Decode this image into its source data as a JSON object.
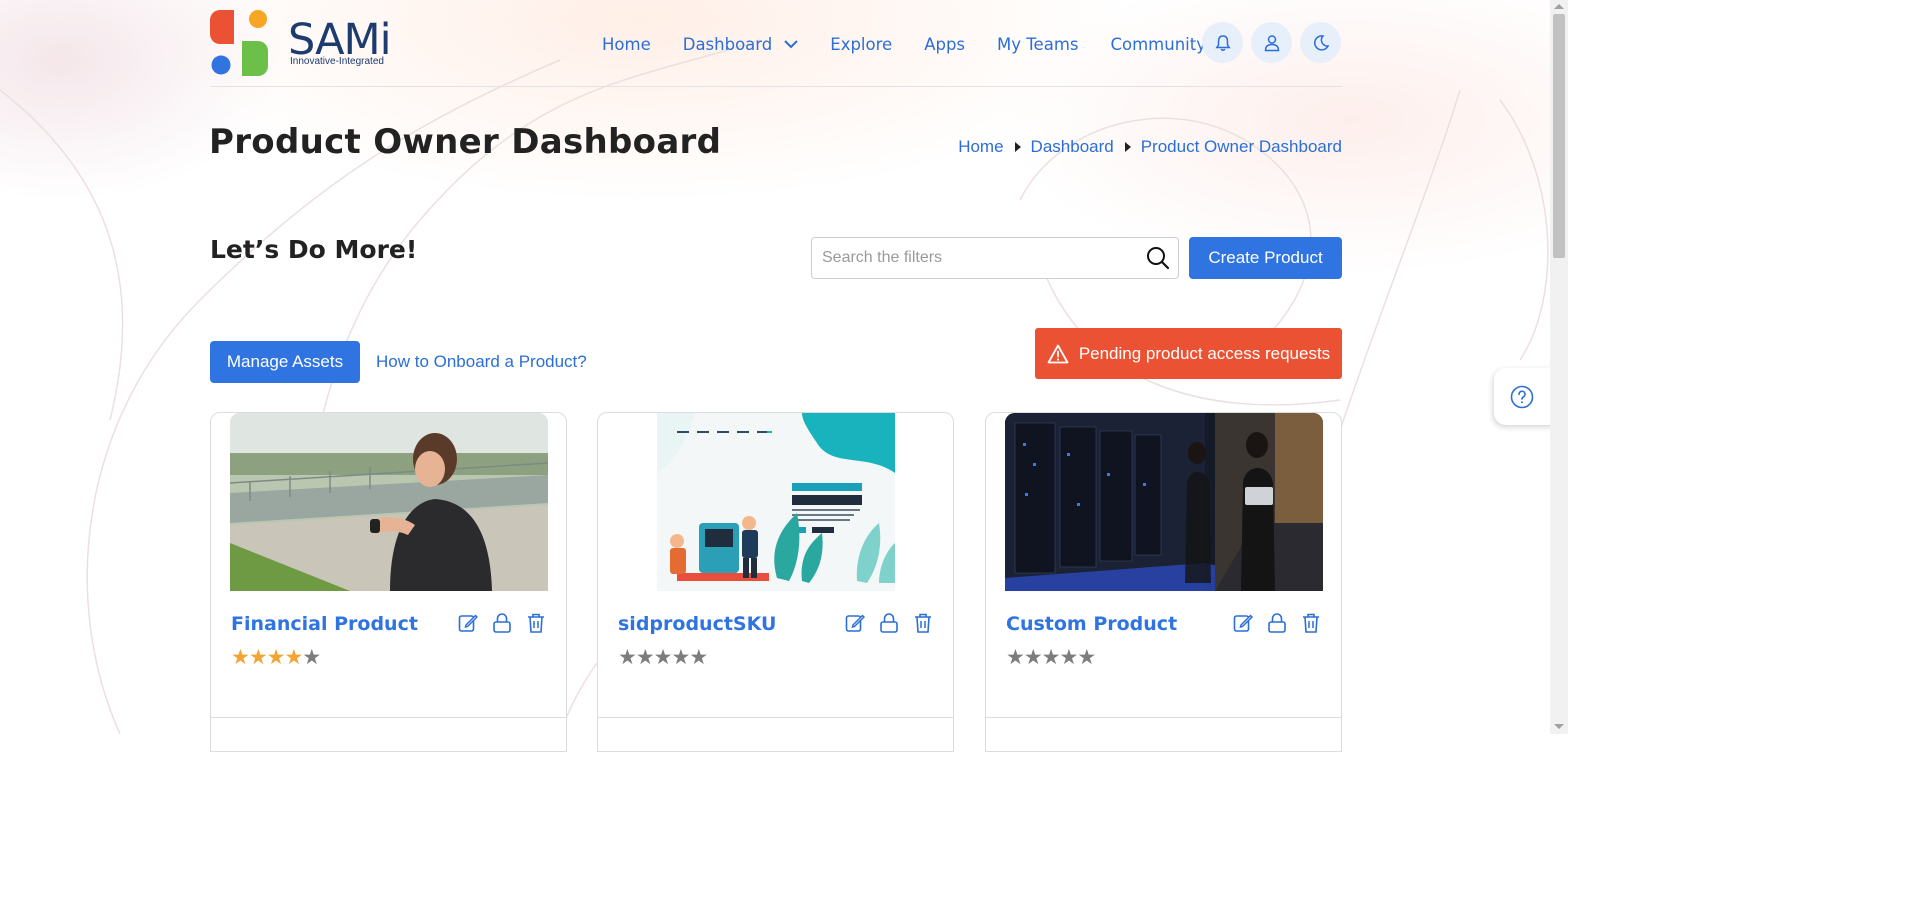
{
  "brand": {
    "name": "SAMi",
    "tagline": "Innovative-Integrated",
    "colors": {
      "red": "#ea5233",
      "orange": "#f6a623",
      "blue": "#2f74e0",
      "green": "#6cc04a",
      "navy": "#1c3b6e"
    }
  },
  "nav": {
    "items": [
      {
        "label": "Home"
      },
      {
        "label": "Dashboard",
        "dropdown": true
      },
      {
        "label": "Explore"
      },
      {
        "label": "Apps"
      },
      {
        "label": "My Teams"
      },
      {
        "label": "Community",
        "dropdown": true
      }
    ],
    "icons": [
      "bell-icon",
      "user-icon",
      "moon-icon"
    ]
  },
  "page": {
    "title": "Product Owner Dashboard",
    "breadcrumb": [
      "Home",
      "Dashboard",
      "Product Owner Dashboard"
    ],
    "subtitle": "Let’s Do More!"
  },
  "search": {
    "placeholder": "Search the filters",
    "value": ""
  },
  "actions": {
    "create_product": "Create Product",
    "manage_assets": "Manage Assets",
    "onboard_link": "How to Onboard a Product?",
    "pending_requests": "Pending product access requests"
  },
  "cards": [
    {
      "title": "Financial Product",
      "rating": 4,
      "max_rating": 5,
      "image": "woman checking smartwatch outdoors"
    },
    {
      "title": "sidproductSKU",
      "rating": 0,
      "max_rating": 5,
      "image": "banking facilities illustration"
    },
    {
      "title": "Custom Product",
      "rating": 0,
      "max_rating": 5,
      "image": "woman with laptop in server room"
    }
  ]
}
